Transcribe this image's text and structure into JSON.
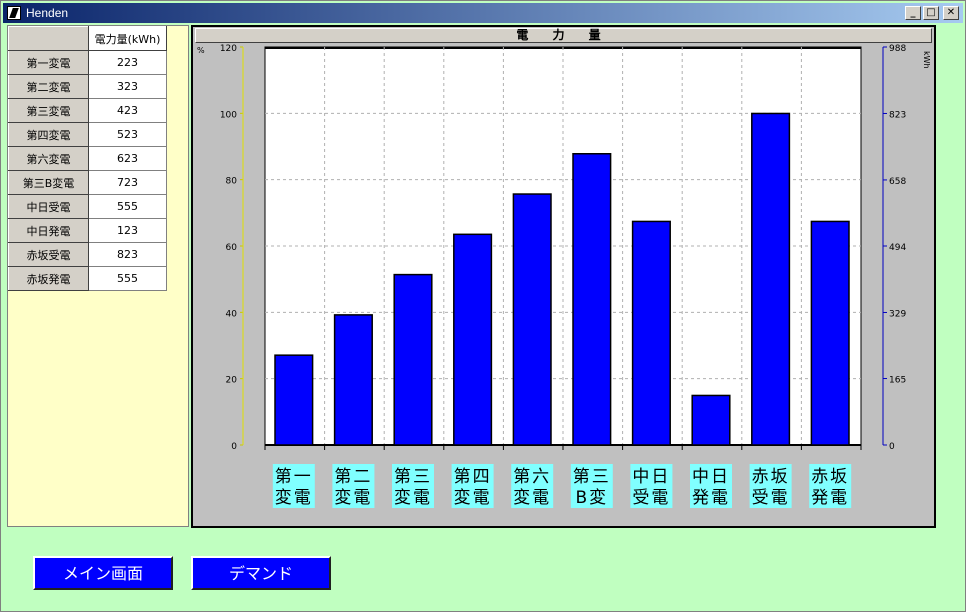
{
  "window": {
    "title": "Henden"
  },
  "window_buttons": {
    "minimize": "_",
    "maximize": "□",
    "close": "✕"
  },
  "table": {
    "header": "電力量(kWh)",
    "rows": [
      {
        "name": "第一変電",
        "value": "223"
      },
      {
        "name": "第二変電",
        "value": "323"
      },
      {
        "name": "第三変電",
        "value": "423"
      },
      {
        "name": "第四変電",
        "value": "523"
      },
      {
        "name": "第六変電",
        "value": "623"
      },
      {
        "name": "第三B変電",
        "value": "723"
      },
      {
        "name": "中日受電",
        "value": "555"
      },
      {
        "name": "中日発電",
        "value": "123"
      },
      {
        "name": "赤坂受電",
        "value": "823"
      },
      {
        "name": "赤坂発電",
        "value": "555"
      }
    ]
  },
  "buttons": {
    "main": "メイン画面",
    "demand": "デマンド"
  },
  "chart_data": {
    "type": "bar",
    "title": "電 力 量",
    "categories": [
      [
        "第一",
        "変電"
      ],
      [
        "第二",
        "変電"
      ],
      [
        "第三",
        "変電"
      ],
      [
        "第四",
        "変電"
      ],
      [
        "第六",
        "変電"
      ],
      [
        "第三",
        "B変"
      ],
      [
        "中日",
        "受電"
      ],
      [
        "中日",
        "発電"
      ],
      [
        "赤坂",
        "受電"
      ],
      [
        "赤坂",
        "発電"
      ]
    ],
    "values": [
      223,
      323,
      423,
      523,
      623,
      723,
      555,
      123,
      823,
      555
    ],
    "left_axis": {
      "unit": "%",
      "ticks": [
        0,
        20,
        40,
        60,
        80,
        100,
        120
      ],
      "ylim": [
        0,
        120
      ]
    },
    "right_axis": {
      "unit": "kWh",
      "ticks": [
        "0",
        "165",
        "329",
        "494",
        "658",
        "823",
        "988"
      ],
      "ylim": [
        0,
        988
      ]
    },
    "bar_color": "#0000ff",
    "label_bg": "#80ffff",
    "grid": true
  }
}
